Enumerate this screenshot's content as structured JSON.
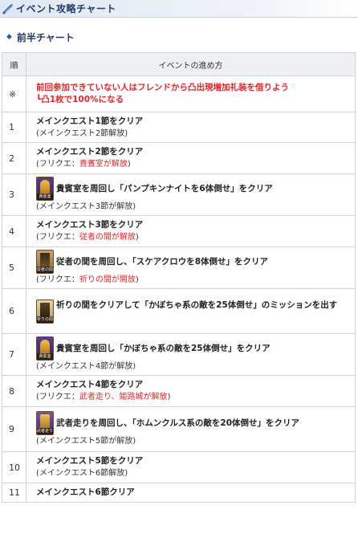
{
  "page": {
    "title": "イベント攻略チャート",
    "section_title": "前半チャート"
  },
  "table": {
    "headers": [
      "順",
      "イベントの進め方"
    ],
    "rows": [
      {
        "num": "※",
        "lines": [
          "前回参加できていない人はフレンドから凸出現増加礼装を借りよう",
          "┗凸1枚で100%になる"
        ]
      },
      {
        "num": "1",
        "main": "メインクエスト1節をクリア",
        "sub": "(メインクエスト2節解放)"
      },
      {
        "num": "2",
        "main": "メインクエスト2節をクリア",
        "sub_pre": "(フリクエ：",
        "sub_red": "貴賓室が解放",
        "sub_post": ")"
      },
      {
        "num": "3",
        "icon_label": "貴賓室",
        "main": "貴賓室を周回し「パンプキンナイトを6体倒せ」をクリア",
        "sub": "(メインクエスト3節が解放)"
      },
      {
        "num": "4",
        "main": "メインクエスト3節をクリア",
        "sub_pre": "(フリクエ：",
        "sub_red": "従者の間が解放",
        "sub_post": ")"
      },
      {
        "num": "5",
        "icon_label": "従者の間",
        "main": "従者の間を周回し、「スケアクロウを8体倒せ」をクリア",
        "sub_pre": "(フリクエ：",
        "sub_red": "祈りの間が開放",
        "sub_post": ")"
      },
      {
        "num": "6",
        "icon_label": "祈りの間",
        "main": "祈りの間をクリアして「かぼちゃ系の敵を25体倒せ」のミッションを出す"
      },
      {
        "num": "7",
        "icon_label": "貴賓室",
        "main": "貴賓室を周回し「かぼちゃ系の敵を25体倒せ」をクリア",
        "sub": "(メインクエスト4節が解放)"
      },
      {
        "num": "8",
        "main": "メインクエスト4節をクリア",
        "sub_pre": "(フリクエ：",
        "sub_red": "武者走り、姫路城が解放",
        "sub_post": ")"
      },
      {
        "num": "9",
        "icon_label": "武者走り",
        "main": "武者走りを周回し、「ホムンクルス系の敵を20体倒せ」をクリア",
        "sub": "(メインクエスト5節が解放)"
      },
      {
        "num": "10",
        "main": "メインクエスト5節をクリア",
        "sub": "(メインクエスト6節解放)"
      },
      {
        "num": "11",
        "main": "メインクエスト6節クリア"
      }
    ]
  },
  "icons": {
    "header": "blade-emblem-icon",
    "section": "diamond-icon",
    "treasure_room": "treasure-room-quest-icon",
    "servant_room": "servant-room-quest-icon",
    "prayer_room": "prayer-room-quest-icon",
    "samurai_walk": "samurai-walk-quest-icon"
  },
  "colors": {
    "accent_blue": "#1f3a63",
    "highlight_red": "#e8252a",
    "header_bg": "#eef0f3",
    "border": "#cfd4da"
  }
}
